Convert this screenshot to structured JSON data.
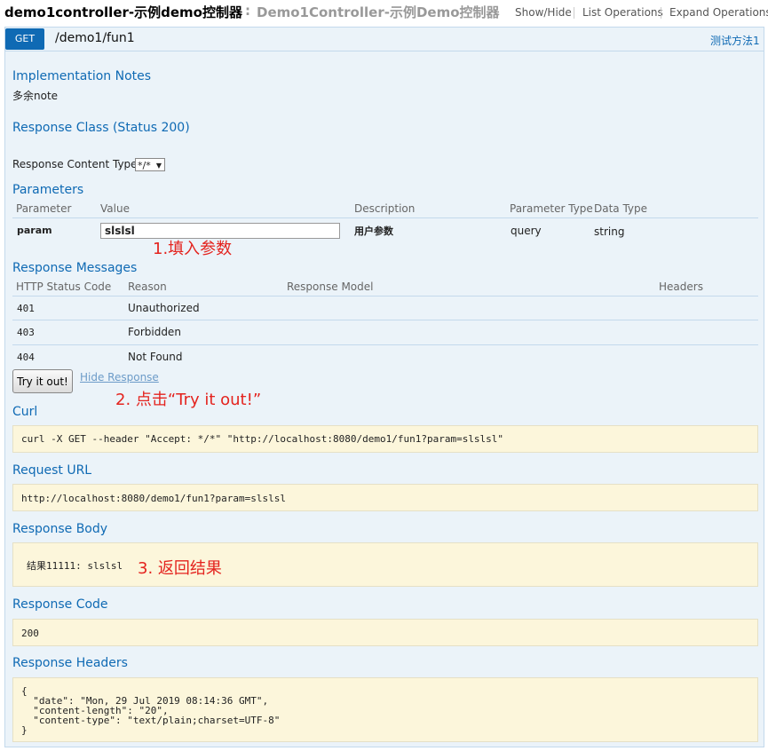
{
  "header": {
    "title": "demo1controller-示例demo控制器",
    "separator": ":",
    "subtitle": "Demo1Controller-示例Demo控制器",
    "links": [
      "Show/Hide",
      "List Operations",
      "Expand Operations"
    ]
  },
  "operation": {
    "method": "GET",
    "path": "/demo1/fun1",
    "summary": "测试方法1"
  },
  "implementation_notes": {
    "heading": "Implementation Notes",
    "text": "多余note"
  },
  "response_class": {
    "heading": "Response Class (Status 200)"
  },
  "response_content_type": {
    "label": "Response Content Type",
    "value": "*/*"
  },
  "parameters": {
    "heading": "Parameters",
    "columns": [
      "Parameter",
      "Value",
      "Description",
      "Parameter Type",
      "Data Type"
    ],
    "row": {
      "name": "param",
      "value": "slslsl",
      "description": "用户参数",
      "type": "query",
      "data_type": "string"
    }
  },
  "response_messages": {
    "heading": "Response Messages",
    "columns": [
      "HTTP Status Code",
      "Reason",
      "Response Model",
      "Headers"
    ],
    "rows": [
      {
        "code": "401",
        "reason": "Unauthorized"
      },
      {
        "code": "403",
        "reason": "Forbidden"
      },
      {
        "code": "404",
        "reason": "Not Found"
      }
    ]
  },
  "buttons": {
    "try_it_out": "Try it out!",
    "hide_response": "Hide Response"
  },
  "annotations": {
    "step1": "1.填入参数",
    "step2": "2. 点击“Try it out!”",
    "step3": "3. 返回结果"
  },
  "curl": {
    "heading": "Curl",
    "command": "curl -X GET --header \"Accept: */*\" \"http://localhost:8080/demo1/fun1?param=slslsl\""
  },
  "request_url": {
    "heading": "Request URL",
    "url": "http://localhost:8080/demo1/fun1?param=slslsl"
  },
  "response_body": {
    "heading": "Response Body",
    "text": "结果11111: slslsl"
  },
  "response_code": {
    "heading": "Response Code",
    "value": "200"
  },
  "response_headers": {
    "heading": "Response Headers",
    "text": "{\n  \"date\": \"Mon, 29 Jul 2019 08:14:36 GMT\",\n  \"content-length\": \"20\",\n  \"content-type\": \"text/plain;charset=UTF-8\"\n}"
  }
}
